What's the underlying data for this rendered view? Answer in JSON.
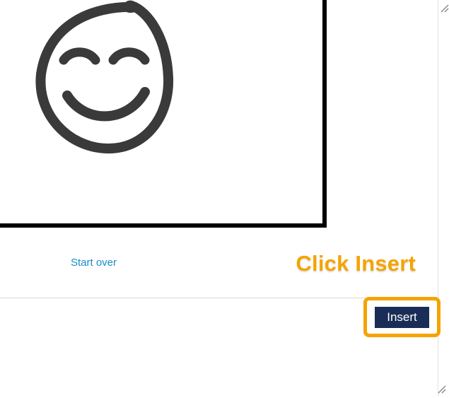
{
  "canvas": {
    "drawing_name": "smiley-face"
  },
  "actions": {
    "start_over_label": "Start over",
    "annotation_label": "Click Insert",
    "insert_label": "Insert"
  }
}
